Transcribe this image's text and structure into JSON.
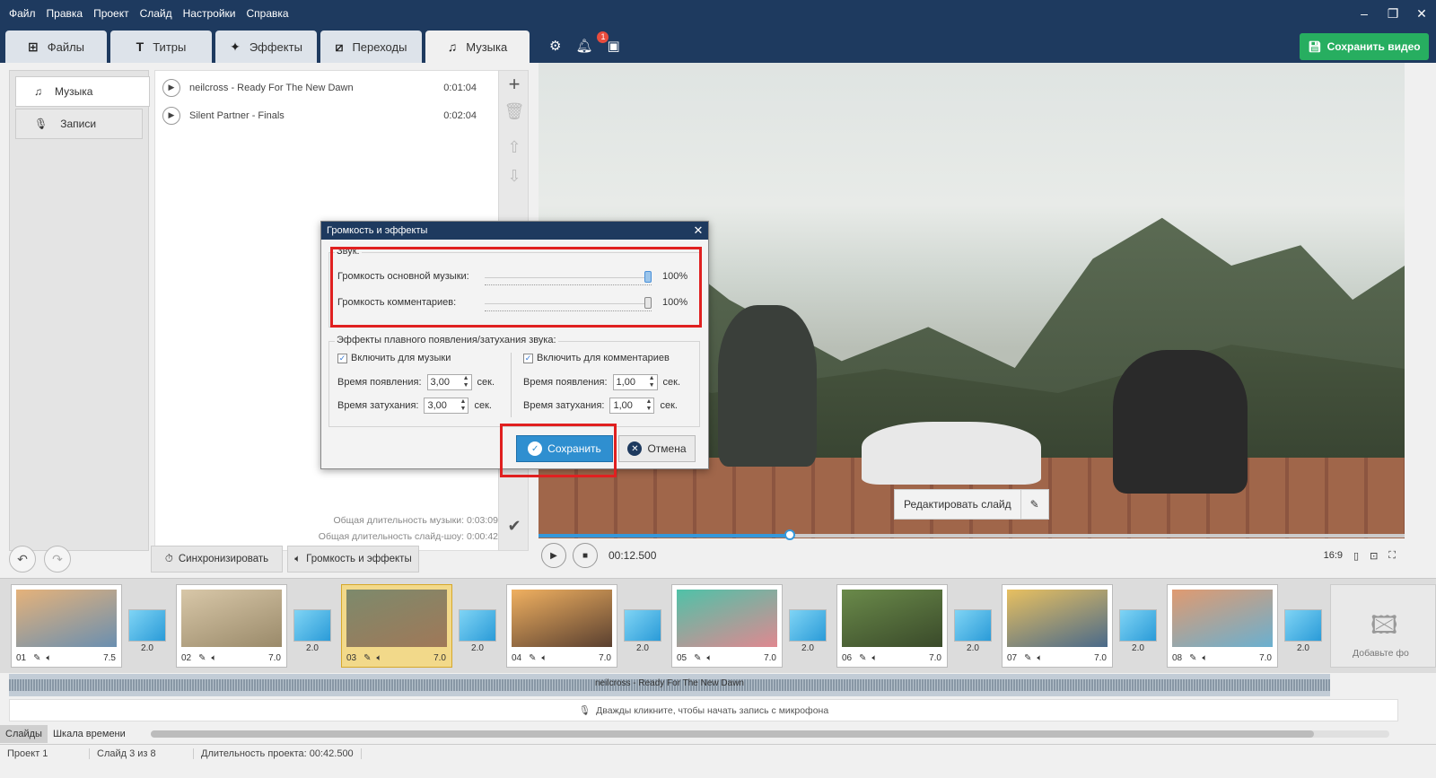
{
  "menu": [
    "Файл",
    "Правка",
    "Проект",
    "Слайд",
    "Настройки",
    "Справка"
  ],
  "window_controls": {
    "minimize": "–",
    "restore": "❐",
    "close": "✕"
  },
  "tabs": [
    {
      "label": "Файлы",
      "icon": "add-file-icon"
    },
    {
      "label": "Титры",
      "icon": "text-icon"
    },
    {
      "label": "Эффекты",
      "icon": "star-icon"
    },
    {
      "label": "Переходы",
      "icon": "transition-icon"
    },
    {
      "label": "Музыка",
      "icon": "music-note-icon"
    }
  ],
  "notification_count": "1",
  "save_video_label": "Сохранить видео",
  "left_panel": {
    "items": [
      "Музыка",
      "Записи"
    ]
  },
  "tracks": [
    {
      "title": "neilcross - Ready For The New Dawn",
      "time": "0:01:04"
    },
    {
      "title": "Silent Partner - Finals",
      "time": "0:02:04"
    }
  ],
  "totals": {
    "music": "Общая длительность музыки: 0:03:09",
    "slideshow": "Общая длительность слайд-шоу: 0:00:42"
  },
  "controls": {
    "sync_label": "Синхронизировать",
    "volume_effects_label": "Громкость и эффекты"
  },
  "dialog": {
    "title": "Громкость и эффекты",
    "sound_group": "Звук:",
    "main_volume_label": "Громкость основной музыки:",
    "main_volume_value": "100%",
    "main_volume_level": 1.0,
    "comments_volume_label": "Громкость комментариев:",
    "comments_volume_value": "100%",
    "comments_volume_level": 1.0,
    "fade_group": "Эффекты плавного появления/затухания звука:",
    "music_enable": "Включить для музыки",
    "comments_enable": "Включить для комментариев",
    "appear_label": "Время появления:",
    "fade_label": "Время затухания:",
    "music_appear": "3,00",
    "music_fade": "3,00",
    "comments_appear": "1,00",
    "comments_fade": "1,00",
    "sec": "сек.",
    "save_label": "Сохранить",
    "cancel_label": "Отмена"
  },
  "edit_slide_label": "Редактировать слайд",
  "player": {
    "time": "00:12.500",
    "aspect": "16:9",
    "progress": 0.29
  },
  "slides": [
    {
      "num": "01",
      "dur": "7.5"
    },
    {
      "num": "02",
      "dur": "7.0"
    },
    {
      "num": "03",
      "dur": "7.0"
    },
    {
      "num": "04",
      "dur": "7.0"
    },
    {
      "num": "05",
      "dur": "7.0"
    },
    {
      "num": "06",
      "dur": "7.0"
    },
    {
      "num": "07",
      "dur": "7.0"
    },
    {
      "num": "08",
      "dur": "7.0"
    }
  ],
  "transition_duration": "2.0",
  "add_photo_label": "Добавьте фо",
  "audio_track_label": "neilcross - Ready For The New Dawn",
  "mic_hint": "Дважды кликните, чтобы начать запись с микрофона",
  "view_tabs": [
    "Слайды",
    "Шкала времени"
  ],
  "status": {
    "project": "Проект 1",
    "slide": "Слайд 3 из 8",
    "duration": "Длительность проекта: 00:42.500"
  }
}
